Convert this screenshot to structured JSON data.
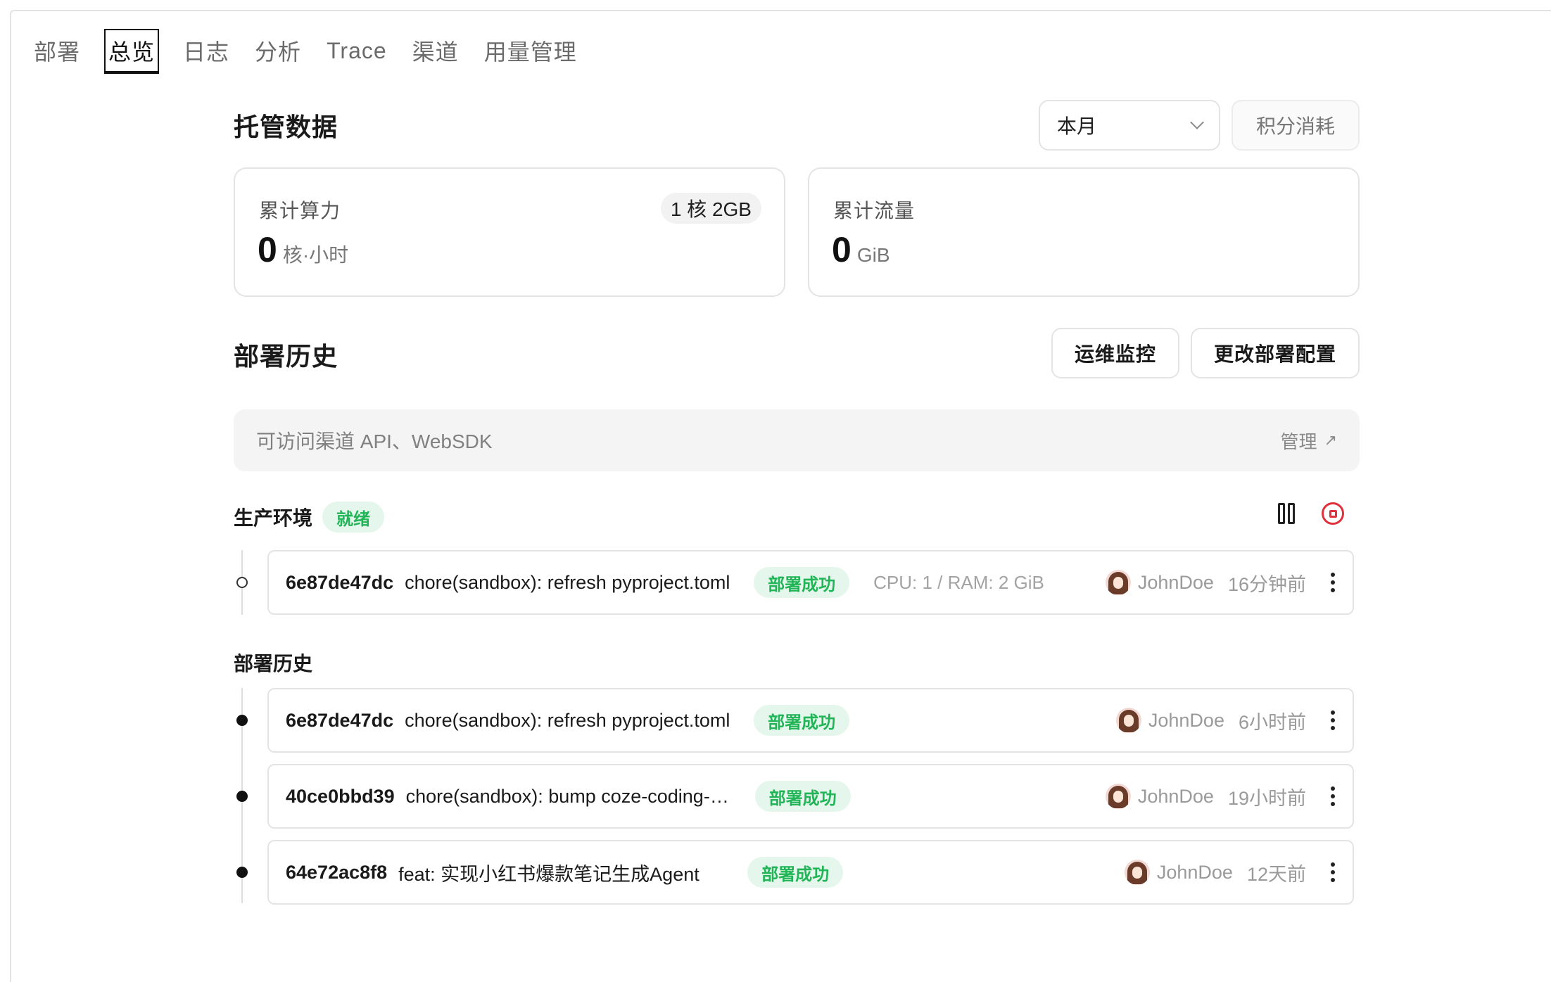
{
  "tabs": [
    {
      "label": "部署"
    },
    {
      "label": "总览"
    },
    {
      "label": "日志"
    },
    {
      "label": "分析"
    },
    {
      "label": "Trace"
    },
    {
      "label": "渠道"
    },
    {
      "label": "用量管理"
    }
  ],
  "hosting": {
    "title": "托管数据",
    "period_select": "本月",
    "points_button": "积分消耗",
    "compute": {
      "label": "累计算力",
      "value": "0",
      "unit": "核·小时",
      "spec": "1 核 2GB"
    },
    "traffic": {
      "label": "累计流量",
      "value": "0",
      "unit": "GiB"
    }
  },
  "history": {
    "title": "部署历史",
    "ops_button": "运维监控",
    "config_button": "更改部署配置",
    "channel_text": "可访问渠道 API、WebSDK",
    "manage_label": "管理",
    "manage_arrow": "↗"
  },
  "production": {
    "title": "生产环境",
    "status": "就绪",
    "deployment": {
      "hash": "6e87de47dc",
      "message": "chore(sandbox): refresh pyproject.toml",
      "status": "部署成功",
      "spec": "CPU: 1 / RAM: 2 GiB",
      "user": "JohnDoe",
      "time": "16分钟前"
    }
  },
  "history_list": {
    "title": "部署历史",
    "items": [
      {
        "hash": "6e87de47dc",
        "message": "chore(sandbox): refresh pyproject.toml",
        "status": "部署成功",
        "user": "JohnDoe",
        "time": "6小时前"
      },
      {
        "hash": "40ce0bbd39",
        "message": "chore(sandbox): bump coze-coding-utils",
        "status": "部署成功",
        "user": "JohnDoe",
        "time": "19小时前"
      },
      {
        "hash": "64e72ac8f8",
        "message": "feat: 实现小红书爆款笔记生成Agent",
        "status": "部署成功",
        "user": "JohnDoe",
        "time": "12天前"
      }
    ]
  },
  "colors": {
    "success_text": "#21b557",
    "success_bg": "#e5f7ec",
    "stop_red": "#e0303c"
  },
  "icons": [
    "chevron-down-icon",
    "arrow-up-right-icon",
    "pause-icon",
    "stop-icon",
    "avatar-icon",
    "more-vertical-icon"
  ]
}
